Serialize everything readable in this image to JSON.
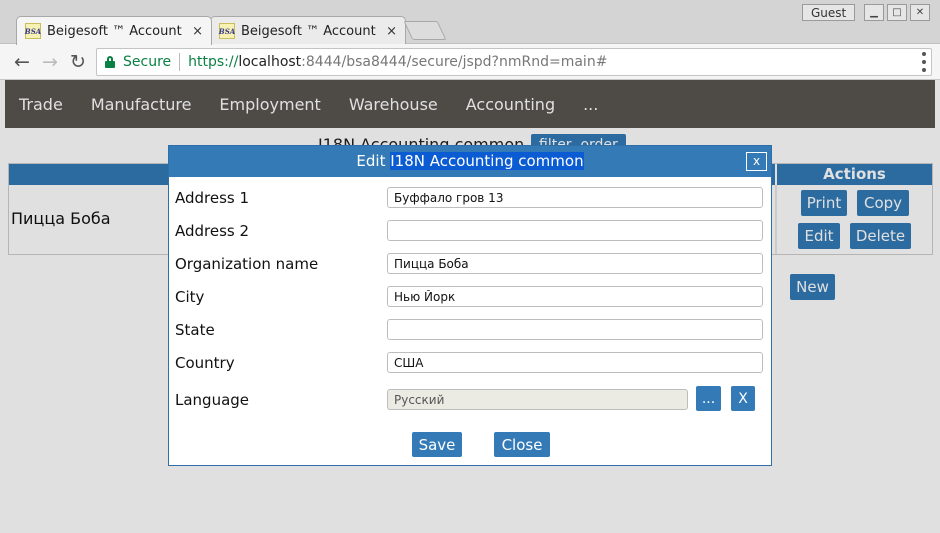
{
  "browser": {
    "tabs": [
      {
        "title": "Beigesoft ™ Account",
        "favicon": "BSA",
        "close": "×"
      },
      {
        "title": "Beigesoft ™ Account",
        "favicon": "BSA",
        "close": "×"
      }
    ],
    "profile": "Guest",
    "window_controls": {
      "minimize": "▁",
      "maximize": "□",
      "close": "✕"
    },
    "nav": {
      "back": "←",
      "forward": "→",
      "reload": "↻"
    },
    "address": {
      "security_label": "Secure",
      "scheme": "https://",
      "host": "localhost",
      "rest": ":8444/bsa8444/secure/jspd?nmRnd=main#"
    }
  },
  "app_nav": {
    "items": [
      "Trade",
      "Manufacture",
      "Employment",
      "Warehouse",
      "Accounting",
      "..."
    ]
  },
  "page": {
    "title": "I18N Accounting common",
    "filter_button": "filter, order",
    "table": {
      "actions_header": "Actions",
      "row_name": "Пицца Боба",
      "actions": {
        "print": "Print",
        "copy": "Copy",
        "edit": "Edit",
        "delete": "Delete"
      }
    },
    "new_button": "New"
  },
  "dialog": {
    "title_prefix": "Edit ",
    "title_entity": "I18N Accounting common",
    "close": "x",
    "fields": [
      {
        "label": "Address 1",
        "value": "Буффало гров 13"
      },
      {
        "label": "Address 2",
        "value": ""
      },
      {
        "label": "Organization name",
        "value": "Пицца Боба"
      },
      {
        "label": "City",
        "value": "Нью Йорк"
      },
      {
        "label": "State",
        "value": ""
      },
      {
        "label": "Country",
        "value": "США"
      }
    ],
    "language": {
      "label": "Language",
      "value": "Русский",
      "pick_button": "...",
      "clear_button": "X"
    },
    "save": "Save",
    "cancel": "Close"
  },
  "colors": {
    "accent": "#337ab7",
    "nav_bg": "#595651",
    "secure": "#0b8043"
  }
}
